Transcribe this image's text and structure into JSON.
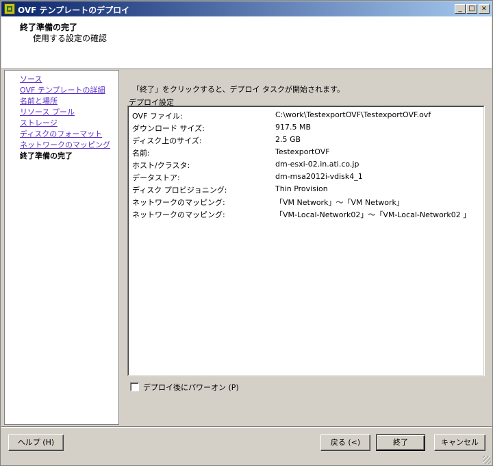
{
  "window": {
    "title": "OVF テンプレートのデプロイ",
    "controls": {
      "minimize": "_",
      "maximize": "□",
      "close": "×"
    }
  },
  "header": {
    "title": "終了準備の完了",
    "subtitle": "使用する設定の確認"
  },
  "nav": {
    "items": [
      {
        "label": "ソース",
        "current": false
      },
      {
        "label": "OVF テンプレートの詳細",
        "current": false
      },
      {
        "label": "名前と場所",
        "current": false
      },
      {
        "label": "リソース プール",
        "current": false
      },
      {
        "label": "ストレージ",
        "current": false
      },
      {
        "label": "ディスクのフォーマット",
        "current": false
      },
      {
        "label": "ネットワークのマッピング",
        "current": false
      },
      {
        "label": "終了準備の完了",
        "current": true
      }
    ]
  },
  "main": {
    "instruction": "「終了」をクリックすると、デプロイ タスクが開始されます。",
    "settings_label": "デプロイ設定",
    "settings": [
      {
        "key": "OVF ファイル:",
        "value": "C:\\work\\TestexportOVF\\TestexportOVF.ovf"
      },
      {
        "key": "ダウンロード サイズ:",
        "value": "917.5 MB"
      },
      {
        "key": "ディスク上のサイズ:",
        "value": "2.5 GB"
      },
      {
        "key": "名前:",
        "value": "TestexportOVF"
      },
      {
        "key": "ホスト/クラスタ:",
        "value": "dm-esxi-02.in.ati.co.jp"
      },
      {
        "key": "データストア:",
        "value": "dm-msa2012i-vdisk4_1"
      },
      {
        "key": "ディスク プロビジョニング:",
        "value": "Thin Provision"
      },
      {
        "key": "ネットワークのマッピング:",
        "value": "「VM Network」〜「VM Network」"
      },
      {
        "key": "ネットワークのマッピング:",
        "value": "「VM-Local-Network02」〜「VM-Local-Network02 」"
      }
    ],
    "power_on_label": "デプロイ後にパワーオン (P)",
    "power_on_checked": false
  },
  "buttons": {
    "help": "ヘルプ (H)",
    "back": "戻る (<)",
    "finish": "終了",
    "cancel": "キャンセル"
  }
}
